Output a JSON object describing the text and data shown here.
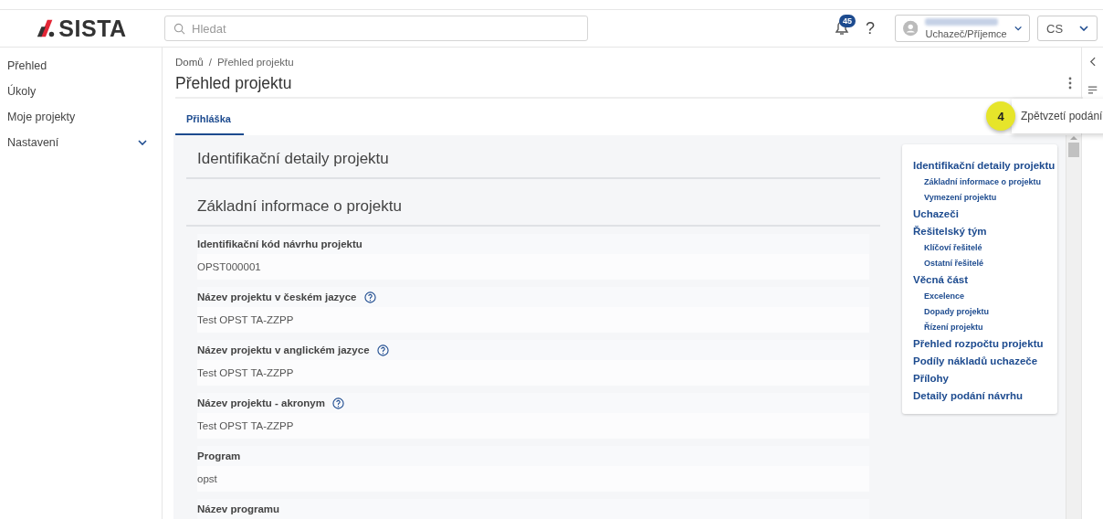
{
  "header": {
    "logo": "SISTA",
    "search": {
      "placeholder": "Hledat"
    },
    "notifications": {
      "count": "45"
    },
    "help": "?",
    "user": {
      "role": "Uchazeč/Příjemce"
    },
    "language": "CS"
  },
  "sidebar": {
    "items": [
      {
        "label": "Přehled",
        "kind": "link"
      },
      {
        "label": "Úkoly",
        "kind": "link"
      },
      {
        "label": "Moje projekty",
        "kind": "link"
      },
      {
        "label": "Nastavení",
        "kind": "group",
        "expanded": false
      }
    ]
  },
  "breadcrumb": {
    "separator": "/",
    "items": [
      "Domů",
      "Přehled projektu"
    ]
  },
  "page_title": "Přehled projektu",
  "tabs": [
    {
      "label": "Přihláška",
      "selected": true
    }
  ],
  "form": {
    "heading": "Identifikační detaily projektu",
    "subheading": "Základní informace o projektu",
    "fields": [
      {
        "label": "Identifikační kód návrhu projektu",
        "help": false,
        "value": "OPST000001"
      },
      {
        "label": "Název projektu v českém jazyce",
        "help": true,
        "value": "Test OPST TA-ZZPP"
      },
      {
        "label": "Název projektu v anglickém jazyce",
        "help": true,
        "value": "Test OPST TA-ZZPP"
      },
      {
        "label": "Název projektu - akronym",
        "help": true,
        "value": "Test OPST TA-ZZPP"
      },
      {
        "label": "Program",
        "help": false,
        "value": "opst"
      },
      {
        "label": "Název programu",
        "help": false
      }
    ]
  },
  "toc": {
    "items": [
      {
        "label": "Identifikační detaily projektu",
        "children": [
          {
            "label": "Základní informace o projektu"
          },
          {
            "label": "Vymezení projektu"
          }
        ]
      },
      {
        "label": "Uchazeči"
      },
      {
        "label": "Řešitelský tým",
        "children": [
          {
            "label": "Klíčoví řešitelé"
          },
          {
            "label": "Ostatní řešitelé"
          }
        ]
      },
      {
        "label": "Věcná část",
        "children": [
          {
            "label": "Excelence"
          },
          {
            "label": "Dopady projektu"
          },
          {
            "label": "Řízení projektu"
          }
        ]
      },
      {
        "label": "Přehled rozpočtu projektu"
      },
      {
        "label": "Podíly nákladů uchazeče"
      },
      {
        "label": "Přílohy"
      },
      {
        "label": "Detaily podání návrhu"
      }
    ]
  },
  "menu": {
    "items": [
      {
        "label": "Zpětvzetí podání",
        "step": "4"
      }
    ]
  }
}
